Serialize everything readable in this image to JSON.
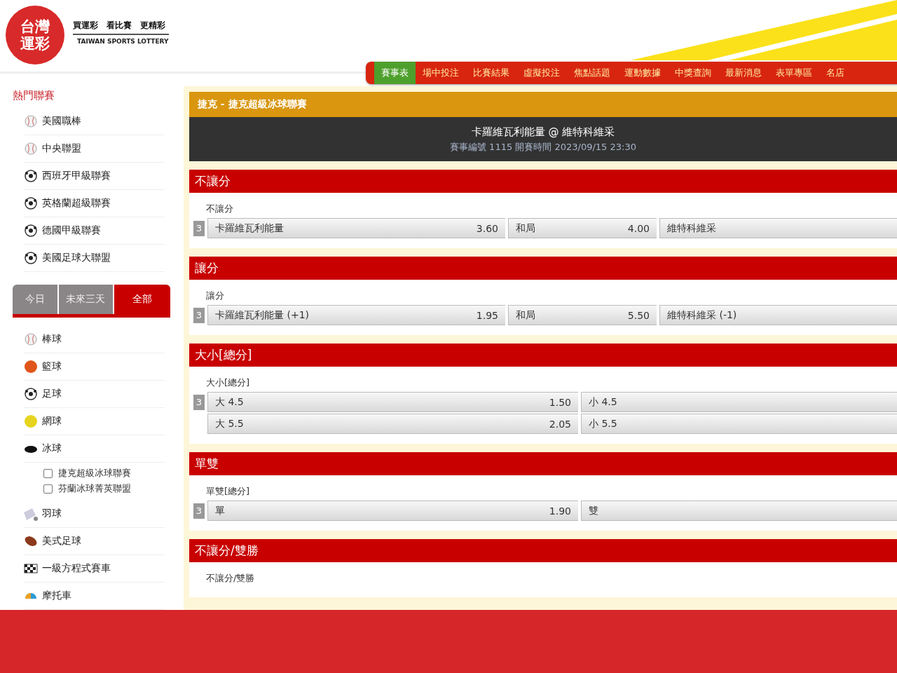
{
  "logo": {
    "mark_top": "台灣",
    "mark_bottom": "運彩",
    "slogan": [
      "買運彩",
      "看比賽",
      "更精彩"
    ],
    "english": "TAIWAN SPORTS LOTTERY"
  },
  "nav": [
    {
      "label": "賽事表",
      "selected": true
    },
    {
      "label": "場中投注",
      "selected": false
    },
    {
      "label": "比賽結果",
      "selected": false
    },
    {
      "label": "虛擬投注",
      "selected": false
    },
    {
      "label": "焦點話題",
      "selected": false
    },
    {
      "label": "運動數據",
      "selected": false
    },
    {
      "label": "中獎查詢",
      "selected": false
    },
    {
      "label": "最新消息",
      "selected": false
    },
    {
      "label": "表單專區",
      "selected": false
    },
    {
      "label": "名店",
      "selected": false
    }
  ],
  "sidebar": {
    "title": "熱門聯賽",
    "hot_leagues": [
      {
        "label": "美國職棒",
        "kind": "baseball"
      },
      {
        "label": "中央聯盟",
        "kind": "baseball"
      },
      {
        "label": "西班牙甲級聯賽",
        "kind": "soccer"
      },
      {
        "label": "英格蘭超級聯賽",
        "kind": "soccer"
      },
      {
        "label": "德國甲級聯賽",
        "kind": "soccer"
      },
      {
        "label": "美國足球大聯盟",
        "kind": "soccer"
      }
    ],
    "tabs": [
      {
        "label": "今日",
        "selected": false
      },
      {
        "label": "未來三天",
        "selected": false
      },
      {
        "label": "全部",
        "selected": true
      }
    ],
    "sports": [
      {
        "label": "棒球",
        "kind": "baseball"
      },
      {
        "label": "籃球",
        "kind": "basketball"
      },
      {
        "label": "足球",
        "kind": "soccer"
      },
      {
        "label": "網球",
        "kind": "tennis"
      },
      {
        "label": "冰球",
        "kind": "hockey",
        "children": [
          {
            "label": "捷克超級冰球聯賽",
            "checked": false
          },
          {
            "label": "芬蘭冰球菁英聯盟",
            "checked": false
          }
        ]
      },
      {
        "label": "羽球",
        "kind": "badminton"
      },
      {
        "label": "美式足球",
        "kind": "football"
      },
      {
        "label": "一級方程式賽車",
        "kind": "racing"
      },
      {
        "label": "摩托車",
        "kind": "motorcycle"
      }
    ]
  },
  "match": {
    "league": "捷克 - 捷克超級冰球聯賽",
    "teams": "卡羅維瓦利能量 @ 維特科維采",
    "info": "賽事編號 1115 開賽時間 2023/09/15 23:30"
  },
  "markets": [
    {
      "title": "不讓分",
      "subtitle": "不讓分",
      "badge": "3",
      "rows": [
        [
          {
            "label": "卡羅維瓦利能量",
            "odds": "3.60"
          },
          {
            "label": "和局",
            "odds": "4.00"
          },
          {
            "label": "維特科維采"
          }
        ]
      ]
    },
    {
      "title": "讓分",
      "subtitle": "讓分",
      "badge": "3",
      "rows": [
        [
          {
            "label": "卡羅維瓦利能量 (+1)",
            "odds": "1.95"
          },
          {
            "label": "和局",
            "odds": "5.50"
          },
          {
            "label": "維特科維采 (-1)"
          }
        ]
      ]
    },
    {
      "title": "大小[總分]",
      "subtitle": "大小[總分]",
      "badge": "3",
      "rows": [
        [
          {
            "label": "大 4.5",
            "odds": "1.50"
          },
          {
            "label": "小 4.5"
          }
        ],
        [
          {
            "label": "大 5.5",
            "odds": "2.05"
          },
          {
            "label": "小 5.5"
          }
        ]
      ]
    },
    {
      "title": "單雙",
      "subtitle": "單雙[總分]",
      "badge": "3",
      "rows": [
        [
          {
            "label": "單",
            "odds": "1.90"
          },
          {
            "label": "雙"
          }
        ]
      ]
    },
    {
      "title": "不讓分/雙勝",
      "subtitle": "不讓分/雙勝"
    }
  ]
}
